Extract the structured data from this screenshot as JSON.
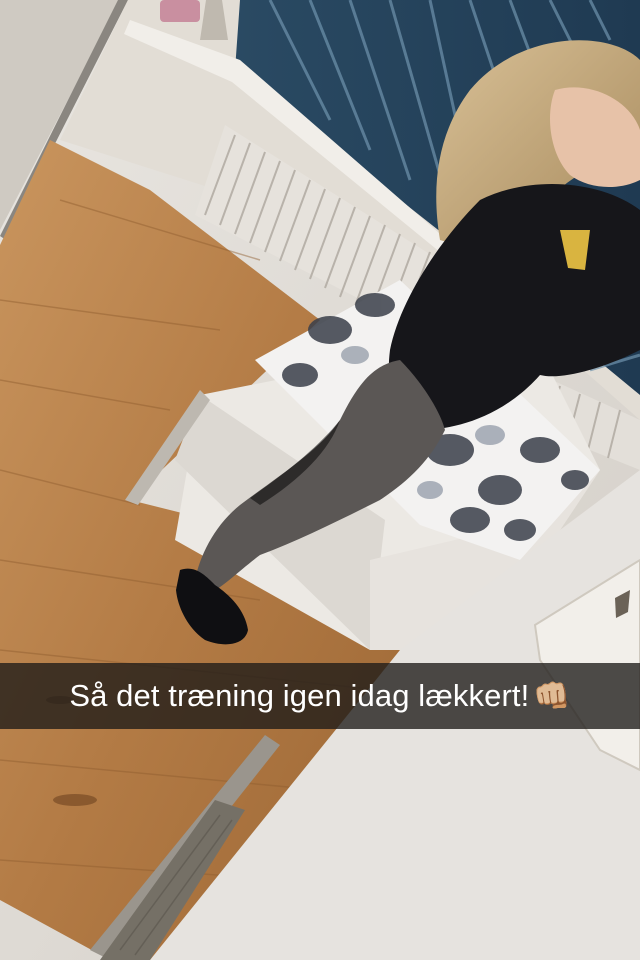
{
  "snap": {
    "caption": "Så det træning igen idag lækkert!",
    "caption_emoji": "👊🏼"
  },
  "colors": {
    "floor": "#b07a45",
    "wall": "#e4e0da",
    "blinds": "#2d4d66",
    "hoodie": "#16161a",
    "leggings": "#5b5755",
    "caption_bar": "#1e1b18"
  }
}
